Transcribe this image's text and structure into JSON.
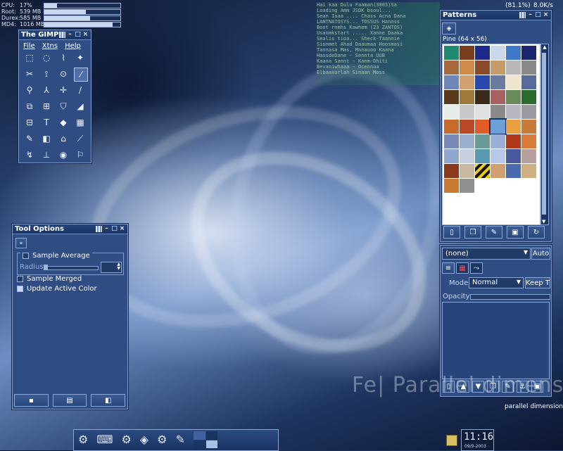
{
  "system_monitor": {
    "cpu_label": "CPU:",
    "cpu_value": "17%",
    "cpu_fraction": 0.17,
    "root_label": "Root:",
    "root_value": "539 MB",
    "root_fraction": 0.55,
    "durex_label": "Durex:",
    "durex_value": "585 MB",
    "durex_fraction": 0.6,
    "md4_label": "MD4:",
    "md4_value": "1016 MB",
    "md4_fraction": 0.9
  },
  "top_right_status": {
    "battery": "(81.1%)",
    "network": "8.0K/s"
  },
  "gimp": {
    "title": "The GIMP",
    "menu": [
      "File",
      "Xtns",
      "Help"
    ]
  },
  "patterns": {
    "title": "Patterns",
    "selected_name": "Pine (64 x 56)",
    "dropdown_value": "(none)",
    "auto_button": "Auto"
  },
  "layers": {
    "mode_label": "Mode:",
    "mode_value": "Normal",
    "keep_label": "Keep T",
    "opacity_label": "Opacity:"
  },
  "tool_options": {
    "title": "Tool Options",
    "sample_average": "Sample Average",
    "radius_label": "Radius:",
    "sample_merged": "Sample Merged",
    "update_active_color": "Update Active Color"
  },
  "wallpaper": {
    "brand_big": "Fe|   Parallel dimension",
    "brand_small": "parallel dimensions"
  },
  "clock": {
    "time": "11:16",
    "date": "09/9-2003"
  },
  "terminal_lines": [
    "Hai kaa Dulu Faaman(3003)Sa",
    "Loading Amm JSDK bsoul...",
    "Sean Iaaa .... Chass Acna Dana",
    "LANTNATOSYS... TOSSUS Hannss",
    "Boot rnmhs Kawhem (23  ZANTOS)",
    "Usanmkstart ..... Xanne Daaka",
    "Sealis tioa... Sheck-Taannie",
    "Sionmet Ahad Daaumaa Hoosmasi",
    "Tannasa Mas, Mnnauoo Kaana",
    "HaosdeDane - Sennta UUB",
    "Kaana Sannt - Kanm-Dhiti",
    "Bevaniwhaaa - Ocennaa",
    "Elbaaxorlah Sinaan Moss"
  ],
  "colors": {
    "panel": "#2f4d82",
    "titlebar": "#1b3563",
    "border": "#7f9ccc"
  }
}
